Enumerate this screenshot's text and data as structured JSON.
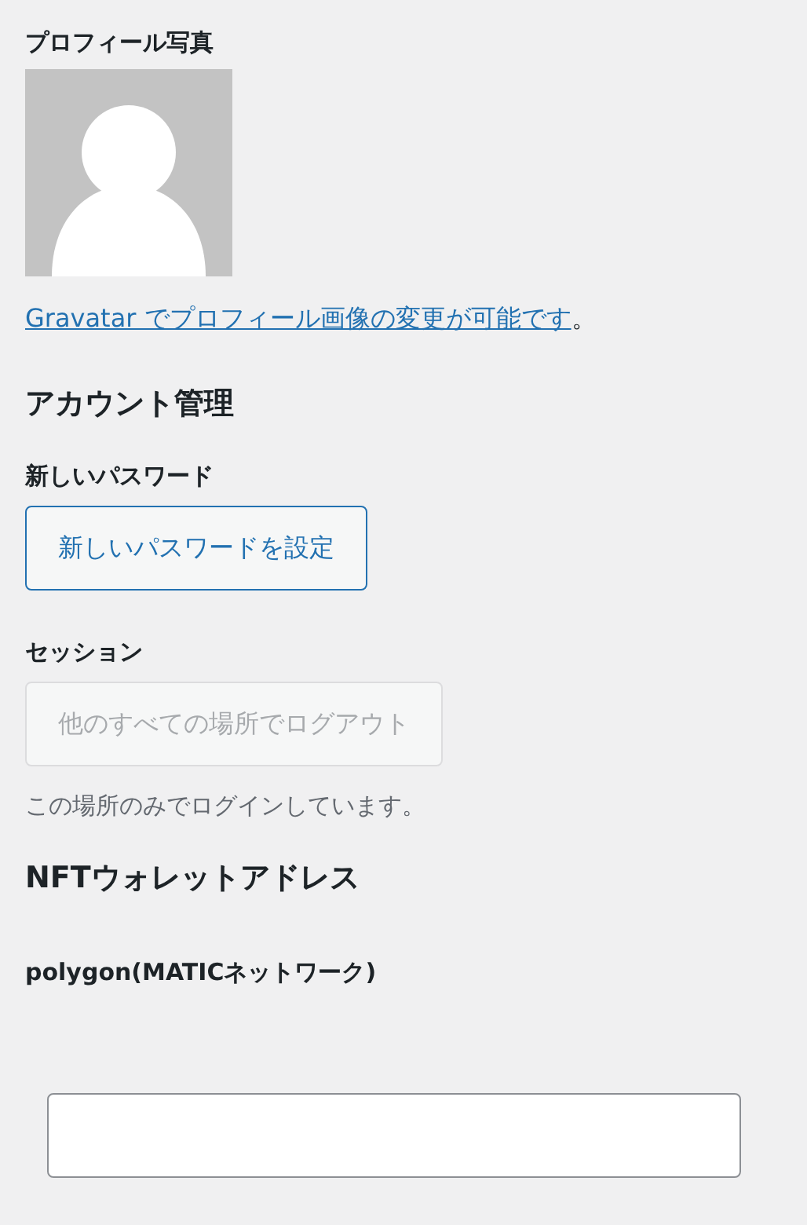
{
  "profile_photo": {
    "label": "プロフィール写真",
    "note_link": "Gravatar でプロフィール画像の変更が可能です",
    "note_tail": "。"
  },
  "account": {
    "heading": "アカウント管理",
    "fields": [
      {
        "label": "新しいパスワード",
        "button": "新しいパスワードを設定",
        "disabled": false
      },
      {
        "label": "セッション",
        "button": "他のすべての場所でログアウト",
        "disabled": true,
        "description": "この場所のみでログインしています。"
      }
    ]
  },
  "nft_wallet": {
    "heading": "NFTウォレットアドレス",
    "network_label": "polygon(MATICネットワーク)"
  }
}
